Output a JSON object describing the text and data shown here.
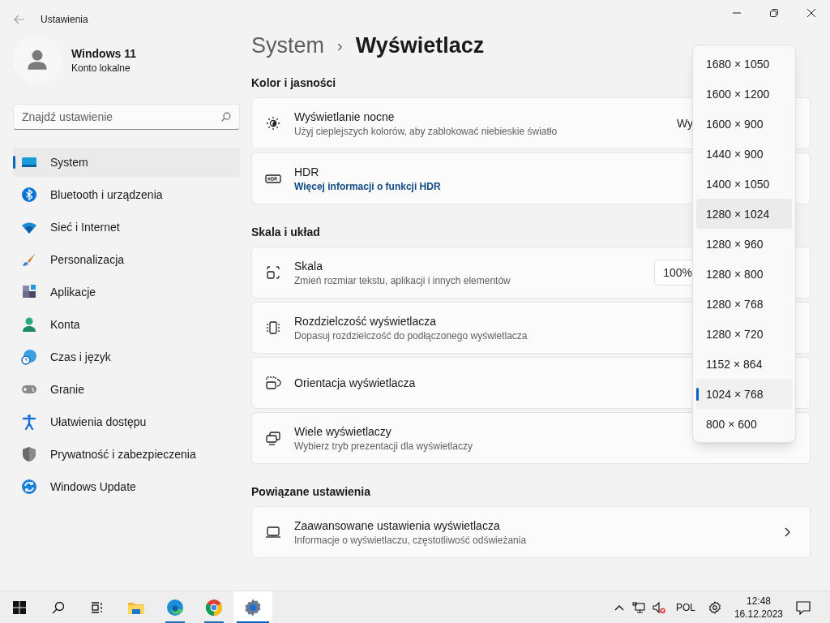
{
  "window": {
    "title": "Ustawienia"
  },
  "profile": {
    "name": "Windows 11",
    "account": "Konto lokalne"
  },
  "search": {
    "placeholder": "Znajdź ustawienie"
  },
  "sidebar": {
    "items": [
      {
        "label": "System",
        "selected": true
      },
      {
        "label": "Bluetooth i urządzenia",
        "selected": false
      },
      {
        "label": "Sieć i Internet",
        "selected": false
      },
      {
        "label": "Personalizacja",
        "selected": false
      },
      {
        "label": "Aplikacje",
        "selected": false
      },
      {
        "label": "Konta",
        "selected": false
      },
      {
        "label": "Czas i język",
        "selected": false
      },
      {
        "label": "Granie",
        "selected": false
      },
      {
        "label": "Ułatwienia dostępu",
        "selected": false
      },
      {
        "label": "Prywatność i zabezpieczenia",
        "selected": false
      },
      {
        "label": "Windows Update",
        "selected": false
      }
    ]
  },
  "breadcrumb": {
    "parent": "System",
    "separator": "›",
    "current": "Wyświetlacz"
  },
  "sections": [
    {
      "title": "Kolor i jasności",
      "cards": [
        {
          "kind": "value",
          "title": "Wyświetlanie nocne",
          "subtitle": "Użyj cieplejszych kolorów, aby zablokować niebieskie światło",
          "value": "Wy"
        },
        {
          "kind": "link",
          "title": "HDR",
          "link": "Więcej informacji o funkcji HDR"
        }
      ]
    },
    {
      "title": "Skala i układ",
      "cards": [
        {
          "kind": "dropdown",
          "title": "Skala",
          "subtitle": "Zmień rozmiar tekstu, aplikacji i innych elementów",
          "value": "100%"
        },
        {
          "kind": "plain",
          "title": "Rozdzielczość wyświetlacza",
          "subtitle": "Dopasuj rozdzielczość do podłączonego wyświetlacza"
        },
        {
          "kind": "plain",
          "title": "Orientacja wyświetlacza"
        },
        {
          "kind": "expand",
          "title": "Wiele wyświetlaczy",
          "subtitle": "Wybierz tryb prezentacji dla wyświetlaczy"
        }
      ]
    },
    {
      "title": "Powiązane ustawienia",
      "cards": [
        {
          "kind": "chevron",
          "title": "Zaawansowane ustawienia wyświetlacza",
          "subtitle": "Informacje o wyświetlaczu, częstotliwość odświeżania"
        }
      ]
    }
  ],
  "resolution_menu": [
    {
      "label": "1680 × 1050",
      "selected": false,
      "hovered": false
    },
    {
      "label": "1600 × 1200",
      "selected": false,
      "hovered": false
    },
    {
      "label": "1600 × 900",
      "selected": false,
      "hovered": false
    },
    {
      "label": "1440 × 900",
      "selected": false,
      "hovered": false
    },
    {
      "label": "1400 × 1050",
      "selected": false,
      "hovered": false
    },
    {
      "label": "1280 × 1024",
      "selected": false,
      "hovered": true
    },
    {
      "label": "1280 × 960",
      "selected": false,
      "hovered": false
    },
    {
      "label": "1280 × 800",
      "selected": false,
      "hovered": false
    },
    {
      "label": "1280 × 768",
      "selected": false,
      "hovered": false
    },
    {
      "label": "1280 × 720",
      "selected": false,
      "hovered": false
    },
    {
      "label": "1152 × 864",
      "selected": false,
      "hovered": false
    },
    {
      "label": "1024 × 768",
      "selected": true,
      "hovered": false
    },
    {
      "label": "800 × 600",
      "selected": false,
      "hovered": false
    }
  ],
  "taskbar": {
    "apps": [
      {
        "running": false,
        "active": false
      },
      {
        "running": true,
        "active": false
      },
      {
        "running": true,
        "active": false
      },
      {
        "running": true,
        "active": true
      }
    ],
    "language": "POL",
    "time": "12:48",
    "date": "16.12.2023"
  }
}
